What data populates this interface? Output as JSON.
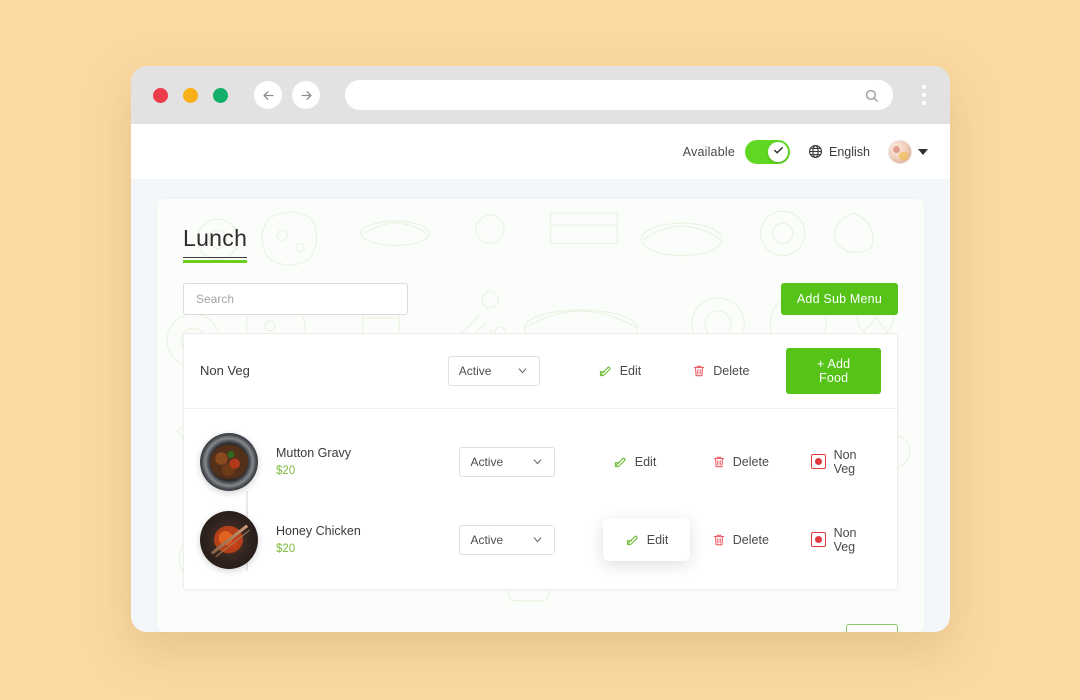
{
  "browser": {
    "traffic_lights": [
      "close-red",
      "minimize-yellow",
      "maximize-green"
    ],
    "back_icon": "arrow-left-icon",
    "forward_icon": "arrow-right-icon",
    "address_value": "",
    "address_placeholder": "",
    "address_search_icon": "search-icon",
    "menu_icon": "kebab-menu-icon"
  },
  "header": {
    "availability_label": "Available",
    "availability_on": true,
    "toggle_check_icon": "check-icon",
    "globe_icon": "globe-icon",
    "language": "English",
    "avatar_icon": "avatar",
    "caret_icon": "caret-down-icon"
  },
  "page": {
    "title": "Lunch",
    "search_placeholder": "Search",
    "search_value": "",
    "add_sub_menu_label": "Add Sub Menu"
  },
  "category": {
    "name": "Non Veg",
    "status": "Active",
    "edit_label": "Edit",
    "delete_label": "Delete",
    "add_food_label": "+ Add Food"
  },
  "foods": [
    {
      "name": "Mutton Gravy",
      "price": "$20",
      "status": "Active",
      "edit_label": "Edit",
      "delete_label": "Delete",
      "diet_label": "Non Veg",
      "thumb": "mutton-gravy-photo"
    },
    {
      "name": "Honey Chicken",
      "price": "$20",
      "status": "Active",
      "edit_label": "Edit",
      "delete_label": "Delete",
      "diet_label": "Non Veg",
      "thumb": "honey-chicken-photo"
    }
  ],
  "colors": {
    "page_background": "#fbd9a2",
    "primary_green": "#55c317",
    "accent_green": "#6ece1e",
    "price_green": "#7dbb3c",
    "danger_red": "#ef5f64",
    "veg_marker_red": "#e2383f",
    "toggle_green": "#5fd723",
    "content_background": "#f4f7fa"
  }
}
